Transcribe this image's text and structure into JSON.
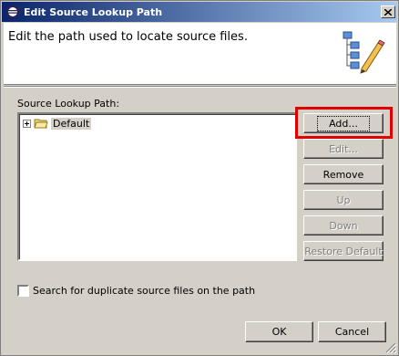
{
  "window": {
    "title": "Edit Source Lookup Path",
    "close_glyph": "✕"
  },
  "header": {
    "description": "Edit the path used to locate source files.",
    "icon": "source-path-edit-icon"
  },
  "list": {
    "label": "Source Lookup Path:",
    "items": [
      {
        "label": "Default",
        "icon": "folder-icon",
        "expandable": true
      }
    ]
  },
  "buttons": {
    "add": "Add...",
    "edit": "Edit...",
    "remove": "Remove",
    "up": "Up",
    "down": "Down",
    "restore_default": "Restore Default"
  },
  "options": {
    "search_duplicates_label": "Search for duplicate source files on the path",
    "search_duplicates_checked": false
  },
  "footer": {
    "ok": "OK",
    "cancel": "Cancel"
  },
  "colors": {
    "dialog_bg": "#d4d0c8",
    "title_gradient_start": "#0a246a",
    "title_gradient_end": "#a6caf0",
    "highlight": "#e00000"
  }
}
